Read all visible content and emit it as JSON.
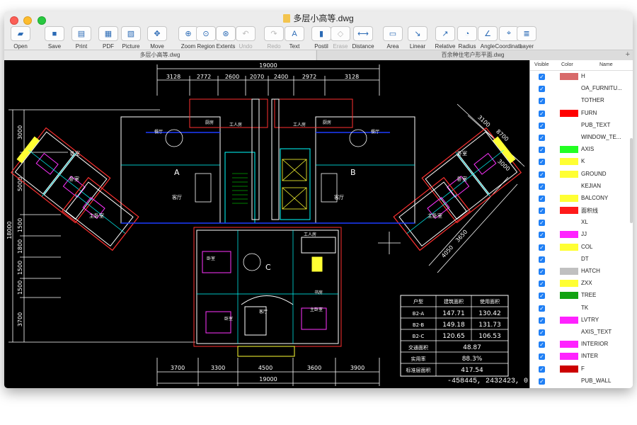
{
  "window": {
    "title": "多层小高等.dwg"
  },
  "toolbar": {
    "items": [
      {
        "label": "Open",
        "icon": "folder-open-icon"
      },
      {
        "label": "Save",
        "icon": "save-icon"
      },
      {
        "label": "Print",
        "icon": "print-icon"
      },
      {
        "label": "PDF",
        "icon": "pdf-icon"
      },
      {
        "label": "Picture",
        "icon": "picture-icon"
      },
      {
        "label": "Move",
        "icon": "move-icon"
      },
      {
        "label": "Zoom",
        "icon": "zoom-icon"
      },
      {
        "label": "Region",
        "icon": "region-icon"
      },
      {
        "label": "Extents",
        "icon": "extents-icon"
      },
      {
        "label": "Undo",
        "icon": "undo-icon"
      },
      {
        "label": "Redo",
        "icon": "redo-icon"
      },
      {
        "label": "Text",
        "icon": "text-icon"
      },
      {
        "label": "Postil",
        "icon": "postil-icon"
      },
      {
        "label": "Erase",
        "icon": "erase-icon"
      },
      {
        "label": "Distance",
        "icon": "distance-icon"
      },
      {
        "label": "Area",
        "icon": "area-icon"
      },
      {
        "label": "Linear",
        "icon": "linear-icon"
      },
      {
        "label": "Relative",
        "icon": "relative-icon"
      },
      {
        "label": "Radius",
        "icon": "radius-icon"
      },
      {
        "label": "Angle",
        "icon": "angle-icon"
      },
      {
        "label": "Coordinate",
        "icon": "coordinate-icon"
      },
      {
        "label": "Layer",
        "icon": "layer-icon"
      }
    ]
  },
  "tabs": [
    {
      "label": "多层小高等.dwg",
      "active": true
    },
    {
      "label": "百余种住宅户形平面.dwg",
      "active": false
    }
  ],
  "tab_add": "+",
  "canvas": {
    "coordinate": "-458445, 2432423, 0",
    "top_total": "19000",
    "top_dims": [
      "3128",
      "2772",
      "2600",
      "2070",
      "2400",
      "2972",
      "3128"
    ],
    "bottom_total": "19000",
    "bottom_dims": [
      "3700",
      "3300",
      "4500",
      "3600",
      "3900"
    ],
    "left_dims": [
      "3000",
      "5000",
      "1500",
      "1800",
      "1500",
      "1500",
      "3700"
    ],
    "left_total": "18000",
    "right_dims": [
      "3100",
      "8700",
      "3000",
      "3650",
      "4050"
    ],
    "unit_labels": [
      "A",
      "B",
      "C"
    ],
    "room_labels": {
      "bedroom": "卧室",
      "master_bedroom": "主卧室",
      "living": "客厅",
      "kitchen": "厨房",
      "dining": "餐厅",
      "maid": "工人房",
      "bathroom": "卫",
      "study": "书房"
    },
    "area_table": {
      "headers": [
        "户型",
        "建筑面积",
        "使用面积"
      ],
      "rows": [
        [
          "B2-A",
          "147.71",
          "130.42"
        ],
        [
          "B2-B",
          "149.18",
          "131.73"
        ],
        [
          "B2-C",
          "120.65",
          "106.53"
        ]
      ],
      "summary": [
        [
          "交通面积",
          "48.87"
        ],
        [
          "实用率",
          "88.3%"
        ],
        [
          "标准层面积",
          "417.54"
        ]
      ]
    }
  },
  "layers_panel": {
    "headers": {
      "visible": "Visible",
      "color": "Color",
      "name": "Name"
    },
    "layers": [
      {
        "name": "H",
        "color": "#d86a6a"
      },
      {
        "name": "OA_FURNITU...",
        "color": ""
      },
      {
        "name": "TOTHER",
        "color": ""
      },
      {
        "name": "FURN",
        "color": "#ff0000"
      },
      {
        "name": "PUB_TEXT",
        "color": ""
      },
      {
        "name": "WINDOW_TE...",
        "color": ""
      },
      {
        "name": "AXIS",
        "color": "#22ff22"
      },
      {
        "name": "K",
        "color": "#ffff33"
      },
      {
        "name": "GROUND",
        "color": "#ffff33"
      },
      {
        "name": "KEJIAN",
        "color": ""
      },
      {
        "name": "BALCONY",
        "color": "#ffff33"
      },
      {
        "name": "面积线",
        "color": "#ff1a1a"
      },
      {
        "name": "XL",
        "color": ""
      },
      {
        "name": "JJ",
        "color": "#ff22ff"
      },
      {
        "name": "COL",
        "color": "#ffff33"
      },
      {
        "name": "DT",
        "color": ""
      },
      {
        "name": "HATCH",
        "color": "#c0c0c0"
      },
      {
        "name": "ZXX",
        "color": "#ffff33"
      },
      {
        "name": "TREE",
        "color": "#12a312"
      },
      {
        "name": "TK",
        "color": ""
      },
      {
        "name": "LVTRY",
        "color": "#ff22ff"
      },
      {
        "name": "AXIS_TEXT",
        "color": ""
      },
      {
        "name": "INTERIOR",
        "color": "#ff22ff"
      },
      {
        "name": "INTER",
        "color": "#ff22ff"
      },
      {
        "name": "F",
        "color": "#cc0000"
      },
      {
        "name": "PUB_WALL",
        "color": ""
      }
    ]
  }
}
